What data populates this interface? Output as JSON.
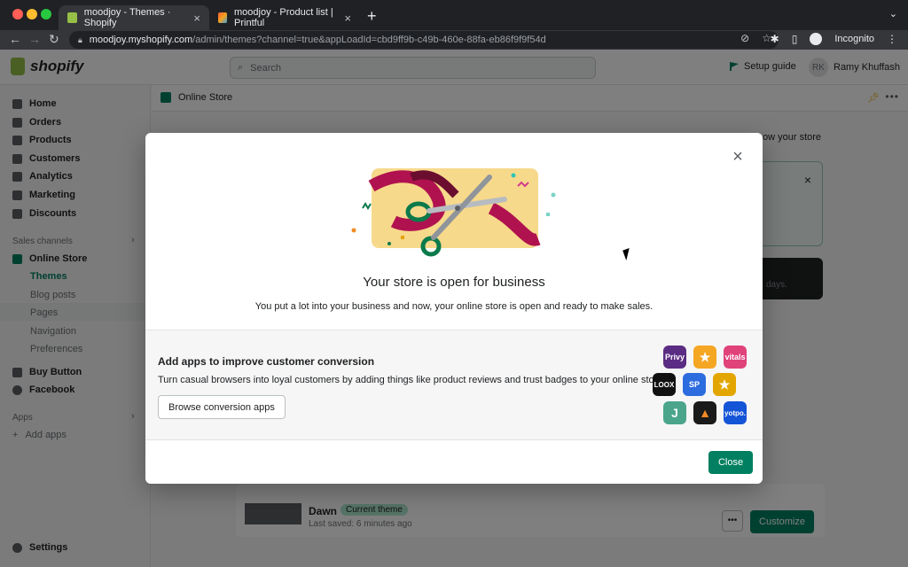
{
  "browser": {
    "tabs": [
      {
        "title": "moodjoy - Themes · Shopify",
        "active": true
      },
      {
        "title": "moodjoy - Product list | Printful",
        "active": false
      }
    ],
    "url_host": "moodjoy.myshopify.com",
    "url_path": "/admin/themes?channel=true&appLoadId=cbd9ff9b-c49b-460e-88fa-eb86f9f9f54d",
    "profile": "Incognito"
  },
  "topbar": {
    "logo": "shopify",
    "search_placeholder": "Search",
    "setup_guide": "Setup guide",
    "user_initials": "RK",
    "user_name": "Ramy Khuffash"
  },
  "sidebar": {
    "items": [
      "Home",
      "Orders",
      "Products",
      "Customers",
      "Analytics",
      "Marketing",
      "Discounts"
    ],
    "sales_channels_heading": "Sales channels",
    "online_store": "Online Store",
    "online_store_subs": [
      "Themes",
      "Blog posts",
      "Pages",
      "Navigation",
      "Preferences"
    ],
    "more_channels": [
      "Buy Button",
      "Facebook"
    ],
    "apps_heading": "Apps",
    "add_apps": "Add apps",
    "settings": "Settings"
  },
  "breadcrumb": {
    "title": "Online Store"
  },
  "background": {
    "preview_hint": "ow your store",
    "days_hint": "days.",
    "theme_name": "Dawn",
    "theme_badge": "Current theme",
    "last_saved": "Last saved: 6 minutes ago",
    "customize": "Customize"
  },
  "modal": {
    "title": "Your store is open for business",
    "subtitle": "You put a lot into your business and now, your online store is open and ready to make sales.",
    "apps_title": "Add apps to improve customer conversion",
    "apps_desc": "Turn casual browsers into loyal customers by adding things like product reviews and trust badges to your online store.",
    "browse_button": "Browse conversion apps",
    "close_button": "Close",
    "app_icons": [
      {
        "label": "Privy",
        "color": "#5b2c83"
      },
      {
        "label": "★",
        "color": "#f5a623"
      },
      {
        "label": "vitals",
        "color": "#e0427a"
      },
      {
        "label": "LOOX",
        "color": "#111111"
      },
      {
        "label": "SP",
        "color": "#2d6cdf"
      },
      {
        "label": "★",
        "color": "#e3a600"
      },
      {
        "label": "J",
        "color": "#4aa58b"
      },
      {
        "label": "▲",
        "color": "#1a1a1a"
      },
      {
        "label": "yotpo.",
        "color": "#1454d6"
      }
    ]
  }
}
